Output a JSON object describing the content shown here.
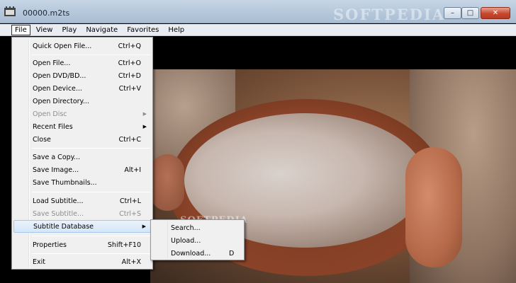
{
  "window": {
    "title": "00000.m2ts",
    "watermark": "SOFTPEDIA",
    "minimize_glyph": "–",
    "maximize_glyph": "□",
    "close_glyph": "✕"
  },
  "menubar": {
    "items": [
      "File",
      "View",
      "Play",
      "Navigate",
      "Favorites",
      "Help"
    ]
  },
  "file_menu": {
    "items": [
      {
        "label": "Quick Open File...",
        "shortcut": "Ctrl+Q"
      },
      {
        "label": "Open File...",
        "shortcut": "Ctrl+O"
      },
      {
        "label": "Open DVD/BD...",
        "shortcut": "Ctrl+D"
      },
      {
        "label": "Open Device...",
        "shortcut": "Ctrl+V"
      },
      {
        "label": "Open Directory...",
        "shortcut": ""
      },
      {
        "label": "Open Disc",
        "shortcut": ""
      },
      {
        "label": "Recent Files",
        "shortcut": ""
      },
      {
        "label": "Close",
        "shortcut": "Ctrl+C"
      },
      {
        "label": "Save a Copy...",
        "shortcut": ""
      },
      {
        "label": "Save Image...",
        "shortcut": "Alt+I"
      },
      {
        "label": "Save Thumbnails...",
        "shortcut": ""
      },
      {
        "label": "Load Subtitle...",
        "shortcut": "Ctrl+L"
      },
      {
        "label": "Save Subtitle...",
        "shortcut": "Ctrl+S"
      },
      {
        "label": "Subtitle Database",
        "shortcut": ""
      },
      {
        "label": "Properties",
        "shortcut": "Shift+F10"
      },
      {
        "label": "Exit",
        "shortcut": "Alt+X"
      }
    ]
  },
  "submenu": {
    "items": [
      {
        "label": "Search...",
        "shortcut": ""
      },
      {
        "label": "Upload...",
        "shortcut": ""
      },
      {
        "label": "Download...",
        "shortcut": "D"
      }
    ]
  },
  "video_watermark": "SOFTPEDIA",
  "colors": {
    "titlebar": "#b4c6da",
    "menu_bg": "#f0f0f0",
    "highlight": "#d4e6f8",
    "close_button": "#c6482f"
  }
}
